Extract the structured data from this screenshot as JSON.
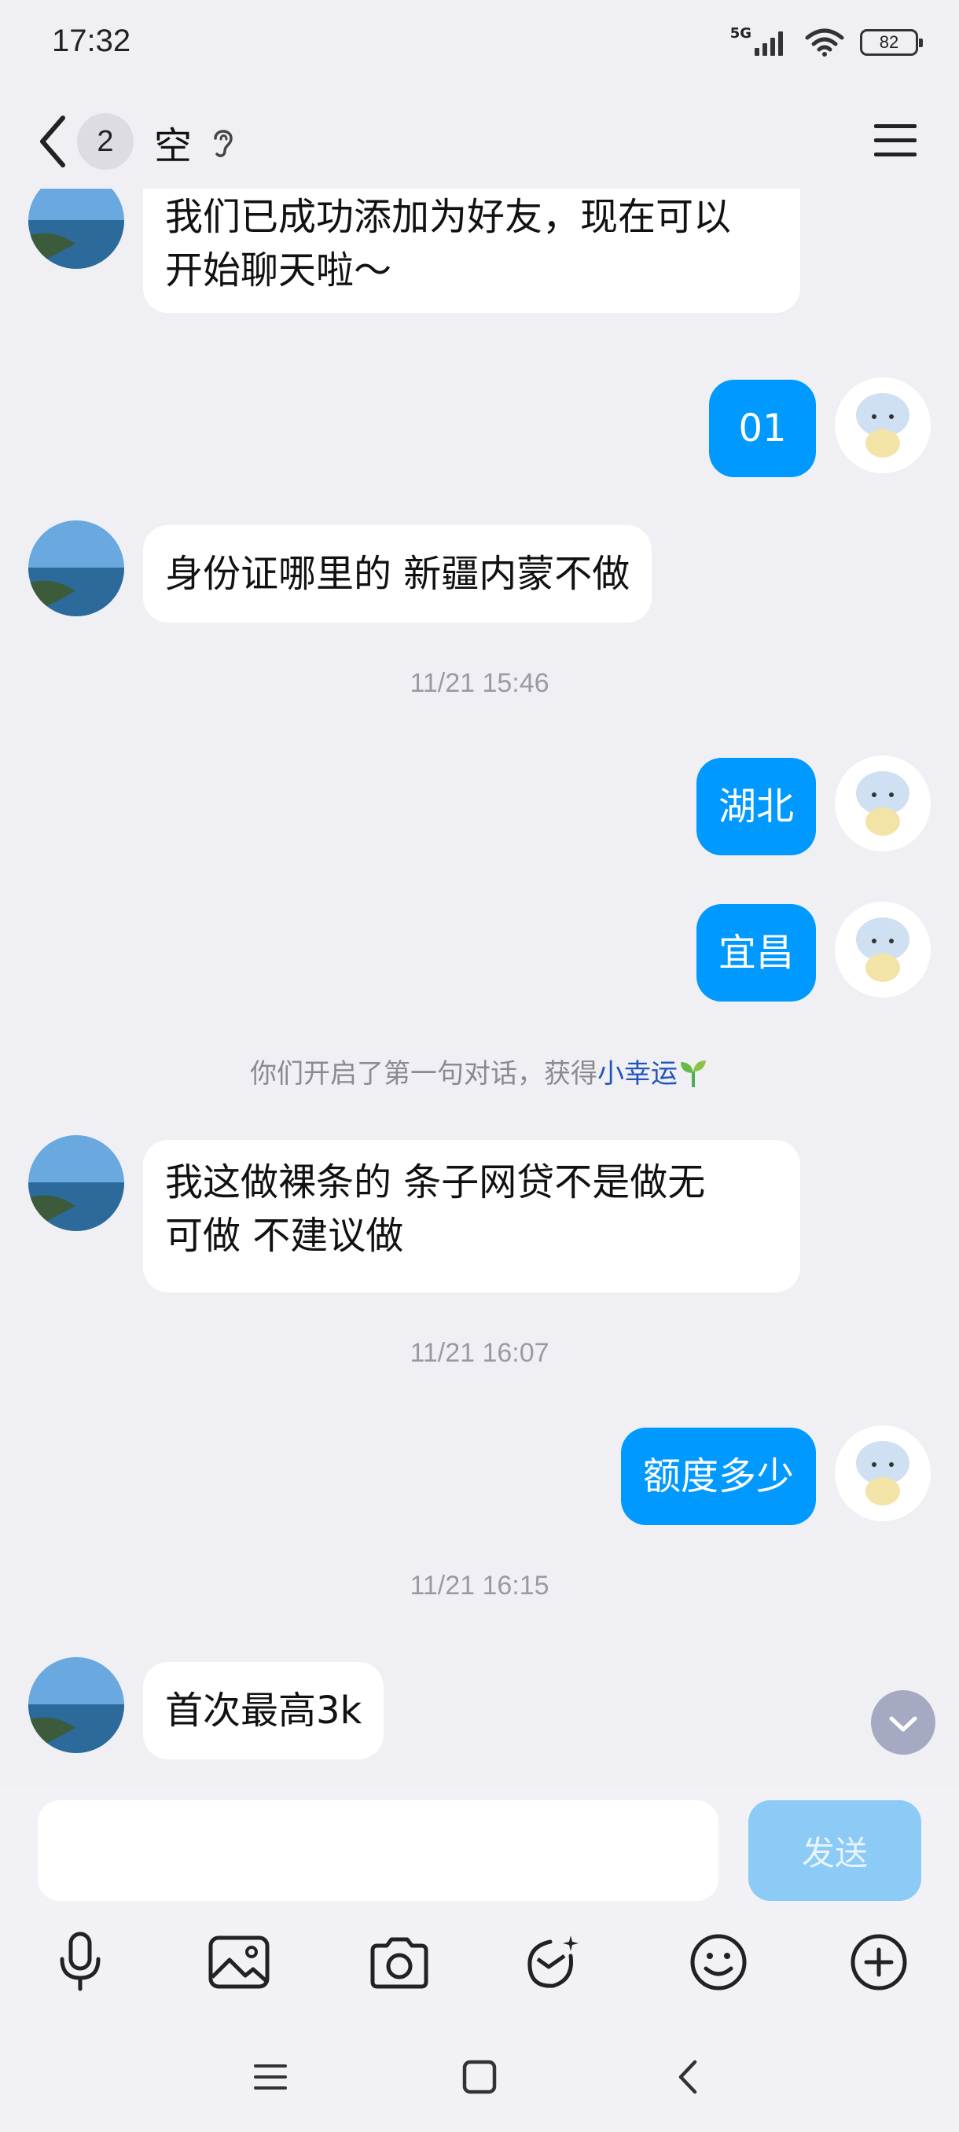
{
  "status_bar": {
    "time": "17:32",
    "network": "5G",
    "battery": "82"
  },
  "header": {
    "unread_count": "2",
    "title": "空"
  },
  "messages": [
    {
      "text_line1": "我们已成功添加为好友，现在可以",
      "text_line2": "开始聊天啦～"
    },
    {
      "text": "01"
    },
    {
      "text": "身份证哪里的 新疆内蒙不做"
    },
    {
      "text": "湖北"
    },
    {
      "text": "宜昌"
    },
    {
      "text_line1": "我这做裸条的 条子网贷不是做无",
      "text_line2": "可做 不建议做"
    },
    {
      "text": "额度多少"
    },
    {
      "text": "首次最高3k"
    }
  ],
  "timestamps": [
    "11/21 15:46",
    "11/21 16:07",
    "11/21 16:15"
  ],
  "system_message": {
    "text": "你们开启了第一句对话，获得",
    "link": "小幸运"
  },
  "input": {
    "value": "",
    "send_label": "发送"
  },
  "icons": {
    "back": "back-chevron-icon",
    "listen": "ear-icon",
    "menu": "hamburger-menu-icon",
    "scroll": "chevron-down-icon",
    "tools": [
      "microphone-icon",
      "image-icon",
      "camera-icon",
      "sticker-icon",
      "emoji-icon",
      "plus-icon"
    ]
  },
  "colors": {
    "outgoing_bubble": "#0099ff",
    "incoming_bubble": "#ffffff",
    "send_button": "#8ccbf6",
    "background": "#f0f0f4"
  }
}
